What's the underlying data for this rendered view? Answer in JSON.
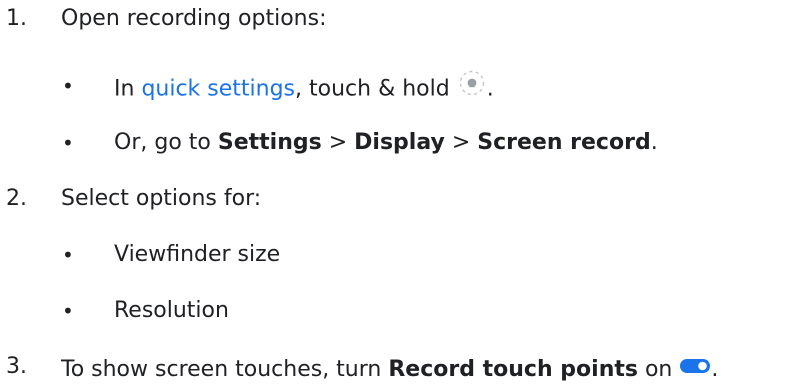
{
  "steps": [
    {
      "number": "1.",
      "text": "Open recording options:",
      "bullets": [
        {
          "prefix": "In ",
          "link": "quick settings",
          "middle": ", touch & hold ",
          "icon": "screen-record-icon",
          "suffix": "."
        },
        {
          "prefix": "Or, go to ",
          "bold1": "Settings",
          "sep1": " > ",
          "bold2": "Display",
          "sep2": " > ",
          "bold3": "Screen record",
          "suffix": "."
        }
      ]
    },
    {
      "number": "2.",
      "text": "Select options for:",
      "bullets": [
        {
          "text": "Viewfinder size"
        },
        {
          "text": "Resolution"
        }
      ]
    },
    {
      "number": "3.",
      "prefix": "To show screen touches, turn ",
      "bold": "Record touch points",
      "middle": " on ",
      "icon": "toggle-on-icon",
      "suffix": "."
    }
  ],
  "colors": {
    "text": "#202124",
    "link": "#1a73e8",
    "toggle": "#1a73e8"
  }
}
